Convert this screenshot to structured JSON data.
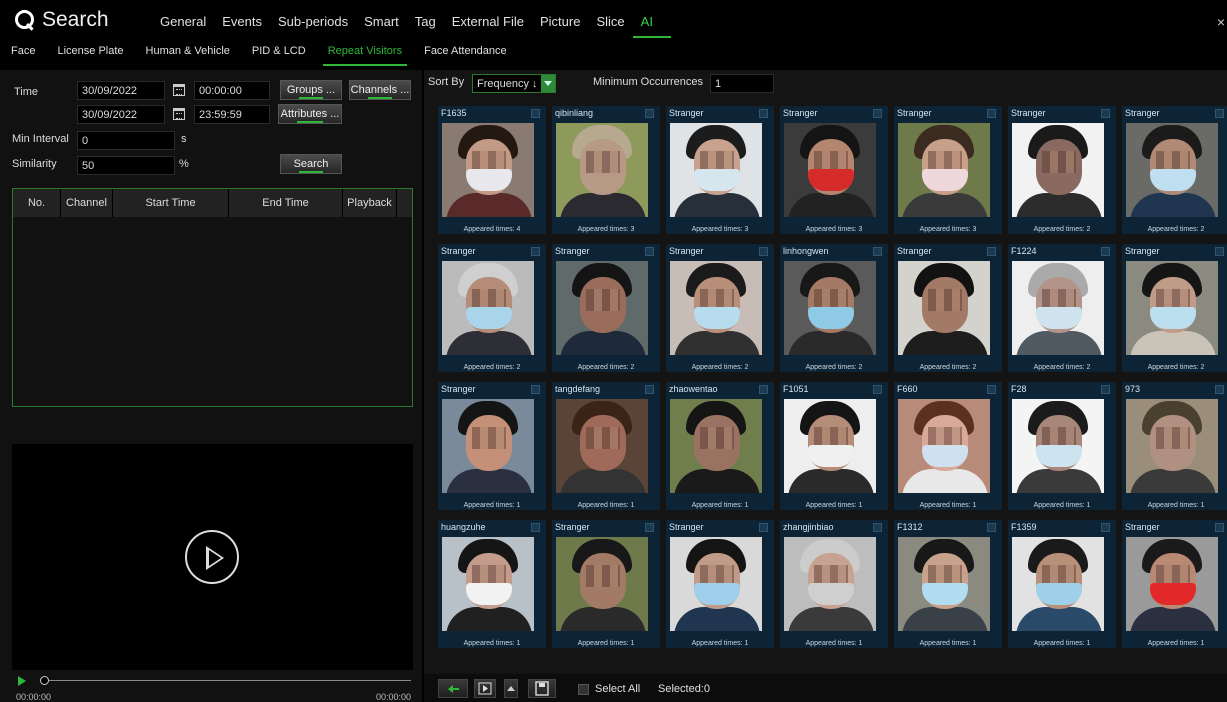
{
  "header": {
    "title": "Search",
    "tabs": [
      "General",
      "Events",
      "Sub-periods",
      "Smart",
      "Tag",
      "External File",
      "Picture",
      "Slice",
      "AI"
    ],
    "active_tab": "AI",
    "close_label": "×"
  },
  "subtabs": {
    "items": [
      "Face",
      "License Plate",
      "Human & Vehicle",
      "PID & LCD",
      "Repeat Visitors",
      "Face Attendance"
    ],
    "active": "Repeat Visitors"
  },
  "filters": {
    "time_label": "Time",
    "start_date": "30/09/2022",
    "start_time": "00:00:00",
    "end_date": "30/09/2022",
    "end_time": "23:59:59",
    "groups_button": "Groups ...",
    "channels_button": "Channels ...",
    "attributes_button": "Attributes ...",
    "min_interval_label": "Min Interval",
    "min_interval_value": "0",
    "min_interval_unit": "s",
    "similarity_label": "Similarity",
    "similarity_value": "50",
    "similarity_unit": "%",
    "search_button": "Search"
  },
  "table": {
    "columns": [
      "No.",
      "Channel",
      "Start Time",
      "End Time",
      "Playback"
    ],
    "rows": []
  },
  "player": {
    "start_time": "00:00:00",
    "end_time": "00:00:00"
  },
  "sort": {
    "label": "Sort By",
    "value": "Frequency ↓",
    "min_occurrences_label": "Minimum Occurrences",
    "min_occurrences_value": "1"
  },
  "results": [
    {
      "name": "F1635",
      "times": "Appeared times: 4",
      "skin": "#c39a85",
      "hair": "#241812",
      "mask": "#e8e8ec",
      "bg": "#8a7b72",
      "body": "#5a2a2a"
    },
    {
      "name": "qibinliang",
      "times": "Appeared times: 3",
      "skin": "#b69a86",
      "hair": "#b7a98f",
      "mask": "",
      "bg": "#8e9a5c",
      "body": "#2a2a30"
    },
    {
      "name": "Stranger",
      "times": "Appeared times: 3",
      "skin": "#c8a28e",
      "hair": "#1c1c1c",
      "mask": "#d6e6ee",
      "bg": "#dfe3e6",
      "body": "#27303a"
    },
    {
      "name": "Stranger",
      "times": "Appeared times: 3",
      "skin": "#b5866f",
      "hair": "#141414",
      "mask": "#d62b2b",
      "bg": "#3b3b3b",
      "body": "#222222"
    },
    {
      "name": "Stranger",
      "times": "Appeared times: 3",
      "skin": "#c8a08a",
      "hair": "#3a2a20",
      "mask": "#efd8dc",
      "bg": "#6e7a4a",
      "body": "#3a3a3a"
    },
    {
      "name": "Stranger",
      "times": "Appeared times: 2",
      "skin": "#8a6a60",
      "hair": "#1a1a1a",
      "mask": "",
      "bg": "#f2f2f2",
      "body": "#2c2c2c"
    },
    {
      "name": "Stranger",
      "times": "Appeared times: 2",
      "skin": "#b08a74",
      "hair": "#1b1b1b",
      "mask": "#bfdff0",
      "bg": "#6a6a66",
      "body": "#1f3550"
    },
    {
      "name": "Stranger",
      "times": "Appeared times: 2",
      "skin": "#b48c78",
      "hair": "#cfcfcf",
      "mask": "#a9d4ea",
      "bg": "#bbbbbb",
      "body": "#2e2e36"
    },
    {
      "name": "Stranger",
      "times": "Appeared times: 2",
      "skin": "#9a6c5c",
      "hair": "#141414",
      "mask": "",
      "bg": "#606a6a",
      "body": "#1e2a3a"
    },
    {
      "name": "Stranger",
      "times": "Appeared times: 2",
      "skin": "#b8907a",
      "hair": "#1b1b1b",
      "mask": "#b6dcee",
      "bg": "#c7bdb6",
      "body": "#303030"
    },
    {
      "name": "linhongwen",
      "times": "Appeared times: 2",
      "skin": "#a47a66",
      "hair": "#181818",
      "mask": "#8fcae6",
      "bg": "#5a5a5a",
      "body": "#2a2a2a"
    },
    {
      "name": "Stranger",
      "times": "Appeared times: 2",
      "skin": "#a27a66",
      "hair": "#121212",
      "mask": "",
      "bg": "#d4d2cc",
      "body": "#1d1d1d"
    },
    {
      "name": "F1224",
      "times": "Appeared times: 2",
      "skin": "#b3948a",
      "hair": "#aaaaaa",
      "mask": "#cfe3ee",
      "bg": "#eeeeee",
      "body": "#505a60"
    },
    {
      "name": "Stranger",
      "times": "Appeared times: 2",
      "skin": "#c09c88",
      "hair": "#151515",
      "mask": "#bcdff0",
      "bg": "#8a8a80",
      "body": "#c9c3b8"
    },
    {
      "name": "Stranger",
      "times": "Appeared times: 1",
      "skin": "#c49178",
      "hair": "#141414",
      "mask": "",
      "bg": "#7a8a9a",
      "body": "#2a3040"
    },
    {
      "name": "tangdefang",
      "times": "Appeared times: 1",
      "skin": "#a06a5a",
      "hair": "#3a2418",
      "mask": "",
      "bg": "#5a4438",
      "body": "#333333"
    },
    {
      "name": "zhaowentao",
      "times": "Appeared times: 1",
      "skin": "#9a7262",
      "hair": "#151515",
      "mask": "",
      "bg": "#6f7e4c",
      "body": "#1a1a1a"
    },
    {
      "name": "F1051",
      "times": "Appeared times: 1",
      "skin": "#b48c78",
      "hair": "#141414",
      "mask": "#f0f0f0",
      "bg": "#eeeeee",
      "body": "#2a2a2a"
    },
    {
      "name": "F660",
      "times": "Appeared times: 1",
      "skin": "#d8a898",
      "hair": "#5a3020",
      "mask": "#cfe0ee",
      "bg": "#b88a7a",
      "body": "#e8e8e8"
    },
    {
      "name": "F28",
      "times": "Appeared times: 1",
      "skin": "#a7877a",
      "hair": "#1b1b1b",
      "mask": "#cde3ef",
      "bg": "#f4f4f4",
      "body": "#3a3a3a"
    },
    {
      "name": "973",
      "times": "Appeared times: 1",
      "skin": "#b09080",
      "hair": "#4a4030",
      "mask": "",
      "bg": "#9a8e7a",
      "body": "#3a3a3a"
    },
    {
      "name": "huangzuhe",
      "times": "Appeared times: 1",
      "skin": "#c49c8c",
      "hair": "#151515",
      "mask": "#f2f2f2",
      "bg": "#b8c0c8",
      "body": "#202020"
    },
    {
      "name": "Stranger",
      "times": "Appeared times: 1",
      "skin": "#a27a66",
      "hair": "#181818",
      "mask": "",
      "bg": "#6e7a4a",
      "body": "#2a2a2a"
    },
    {
      "name": "Stranger",
      "times": "Appeared times: 1",
      "skin": "#c09c88",
      "hair": "#141414",
      "mask": "#9fcfea",
      "bg": "#d9d9d9",
      "body": "#1f3550"
    },
    {
      "name": "zhangjinbiao",
      "times": "Appeared times: 1",
      "skin": "#c8a290",
      "hair": "#cccccc",
      "mask": "#cfcfcf",
      "bg": "#bdbdbd",
      "body": "#3a3a3a"
    },
    {
      "name": "F1312",
      "times": "Appeared times: 1",
      "skin": "#c8a28c",
      "hair": "#181818",
      "mask": "#b2dcef",
      "bg": "#8a8a80",
      "body": "#3a4048"
    },
    {
      "name": "F1359",
      "times": "Appeared times: 1",
      "skin": "#b8907a",
      "hair": "#1a1a1a",
      "mask": "#9fd0ea",
      "bg": "#e2e2e2",
      "body": "#2a4a6a"
    },
    {
      "name": "Stranger",
      "times": "Appeared times: 1",
      "skin": "#b88a74",
      "hair": "#1a1a1a",
      "mask": "#e22828",
      "bg": "#9a9a9a",
      "body": "#2a3040"
    }
  ],
  "bottom": {
    "select_all_label": "Select All",
    "selected_label": "Selected:0"
  },
  "colors": {
    "accent": "#2eb83a",
    "card_bg": "#0d2436"
  }
}
